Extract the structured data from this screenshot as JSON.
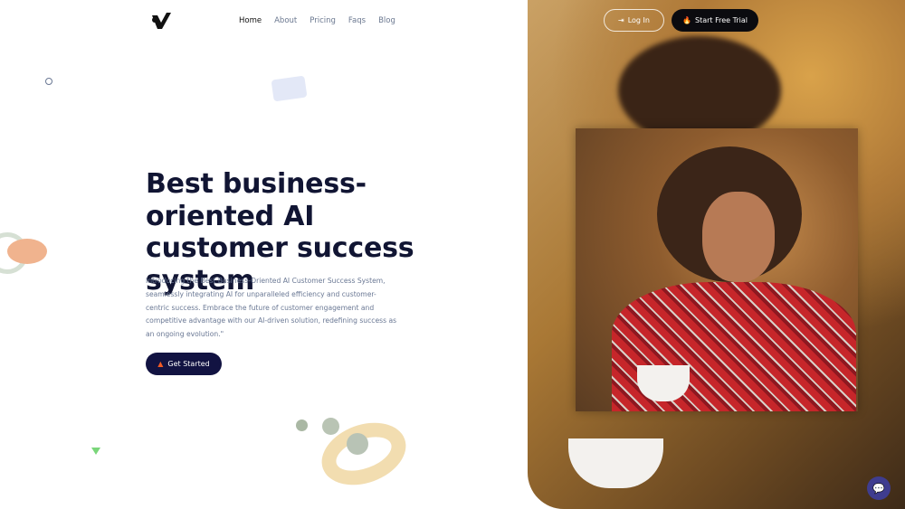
{
  "nav": {
    "items": [
      "Home",
      "About",
      "Pricing",
      "Faqs",
      "Blog"
    ],
    "active": "Home"
  },
  "header": {
    "login_label": "Log In",
    "trial_label": "Start Free Trial"
  },
  "hero": {
    "title": "Best business-oriented AI customer success system",
    "description": "Introducing the Best Business-Oriented AI Customer Success System, seamlessly integrating AI for unparalleled efficiency and customer-centric success. Embrace the future of customer engagement and competitive advantage with our AI-driven solution, redefining success as an ongoing evolution.\"",
    "cta_label": "Get Started"
  },
  "colors": {
    "primary": "#121342",
    "accent": "#f15a24",
    "chat": "#3f3d8f"
  }
}
